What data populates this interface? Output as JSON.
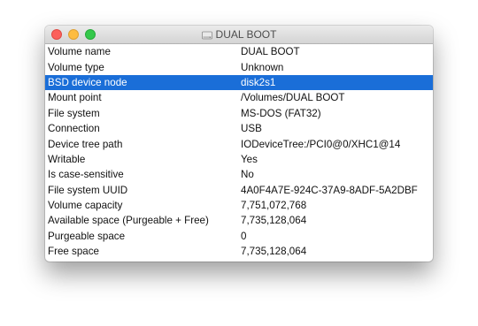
{
  "window": {
    "title": "DUAL BOOT",
    "icon": "disk-icon"
  },
  "rows": [
    {
      "label": "Volume name",
      "value": "DUAL BOOT"
    },
    {
      "label": "Volume type",
      "value": "Unknown"
    },
    {
      "label": "BSD device node",
      "value": "disk2s1"
    },
    {
      "label": "Mount point",
      "value": "/Volumes/DUAL BOOT"
    },
    {
      "label": "File system",
      "value": "MS-DOS (FAT32)"
    },
    {
      "label": "Connection",
      "value": "USB"
    },
    {
      "label": "Device tree path",
      "value": "IODeviceTree:/PCI0@0/XHC1@14"
    },
    {
      "label": "Writable",
      "value": "Yes"
    },
    {
      "label": "Is case-sensitive",
      "value": "No"
    },
    {
      "label": "File system UUID",
      "value": "4A0F4A7E-924C-37A9-8ADF-5A2DBF"
    },
    {
      "label": "Volume capacity",
      "value": "7,751,072,768"
    },
    {
      "label": "Available space (Purgeable + Free)",
      "value": "7,735,128,064"
    },
    {
      "label": "Purgeable space",
      "value": "0"
    },
    {
      "label": "Free space",
      "value": "7,735,128,064"
    }
  ],
  "selected_row": "BSD device node",
  "colors": {
    "selection": "#1a6ed8",
    "close": "#fc605b",
    "minimize": "#fdbc40",
    "maximize": "#34c84a"
  }
}
